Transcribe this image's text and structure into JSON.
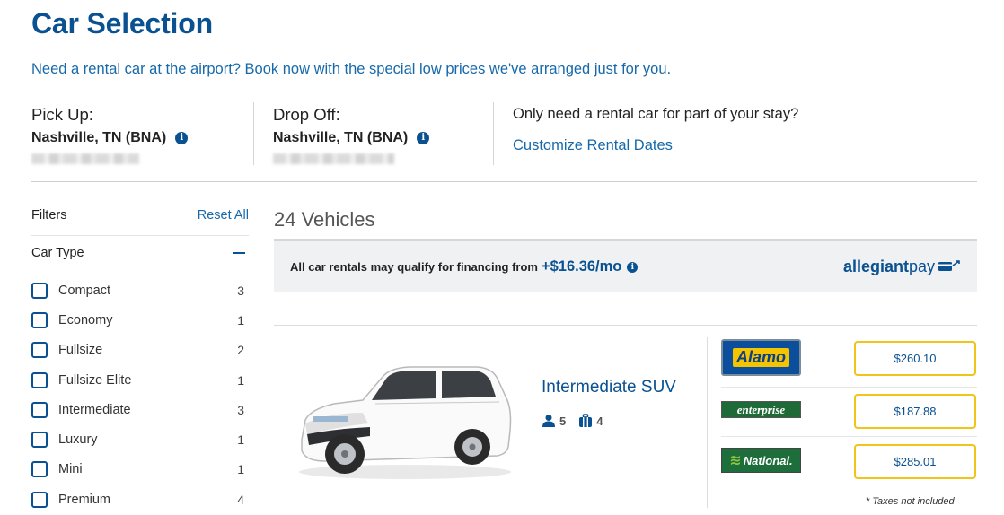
{
  "header": {
    "title": "Car Selection",
    "tagline": "Need a rental car at the airport? Book now with the special low prices we've arranged just for you."
  },
  "pickup": {
    "label": "Pick Up:",
    "location": "Nashville, TN (BNA)"
  },
  "dropoff": {
    "label": "Drop Off:",
    "location": "Nashville, TN (BNA)"
  },
  "partial_stay": {
    "question": "Only need a rental car for part of your stay?",
    "link": "Customize Rental Dates"
  },
  "filters": {
    "label": "Filters",
    "reset": "Reset All",
    "car_type_label": "Car Type",
    "items": [
      {
        "name": "Compact",
        "count": "3"
      },
      {
        "name": "Economy",
        "count": "1"
      },
      {
        "name": "Fullsize",
        "count": "2"
      },
      {
        "name": "Fullsize Elite",
        "count": "1"
      },
      {
        "name": "Intermediate",
        "count": "3"
      },
      {
        "name": "Luxury",
        "count": "1"
      },
      {
        "name": "Mini",
        "count": "1"
      },
      {
        "name": "Premium",
        "count": "4"
      }
    ]
  },
  "results": {
    "count_label": "24 Vehicles",
    "finance_text": "All car rentals may qualify for financing from",
    "finance_amount": "+$16.36/mo",
    "allegiant_bold": "allegiant",
    "allegiant_light": "pay"
  },
  "vehicle": {
    "class": "Intermediate SUV",
    "passengers": "5",
    "bags": "4",
    "vendors": [
      {
        "name": "Alamo",
        "price": "$260.10"
      },
      {
        "name": "enterprise",
        "price": "$187.88"
      },
      {
        "name": "National.",
        "price": "$285.01"
      }
    ],
    "taxes_note": "* Taxes not included"
  },
  "colors": {
    "brand": "#0a5192",
    "link": "#1769aa",
    "price_border": "#f0c419"
  }
}
